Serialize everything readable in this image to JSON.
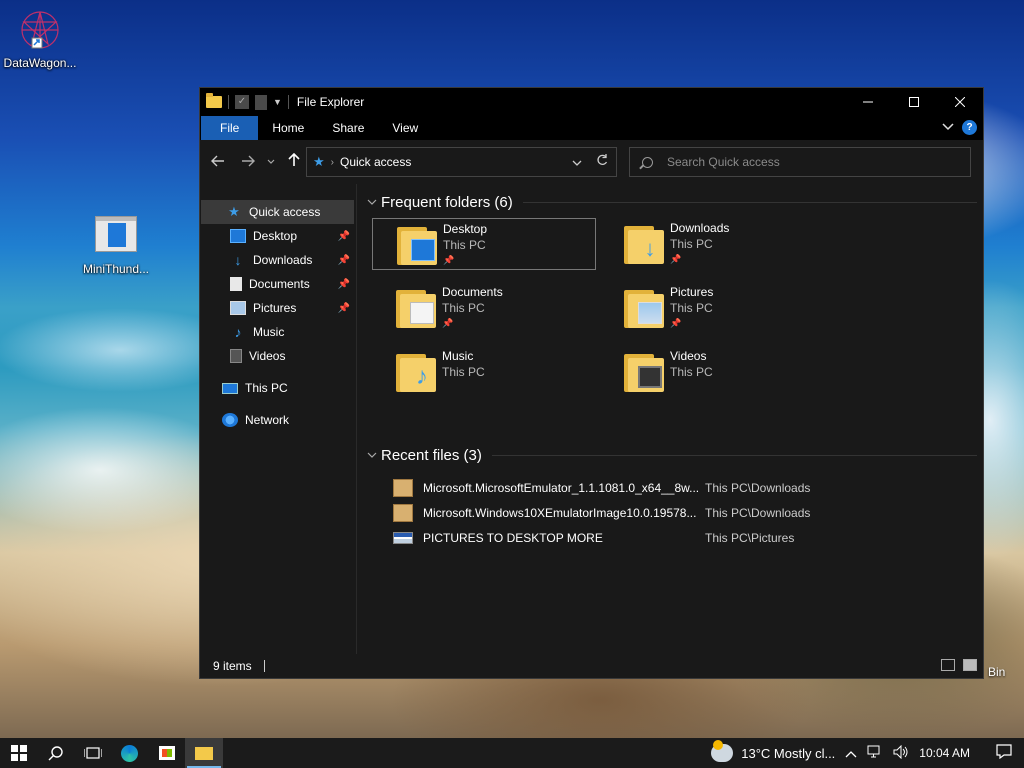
{
  "desktop": {
    "icons": [
      {
        "label": "DataWagon..."
      },
      {
        "label": "MiniThund..."
      }
    ],
    "recycle_label": "Bin"
  },
  "window": {
    "title": "File Explorer",
    "ribbon_tabs": [
      "File",
      "Home",
      "Share",
      "View"
    ],
    "address": {
      "path": "Quick access"
    },
    "search": {
      "placeholder": "Search Quick access"
    },
    "sidebar": {
      "quick_access": "Quick access",
      "items": [
        {
          "label": "Desktop",
          "icon": "desktop-icon",
          "pinned": true
        },
        {
          "label": "Downloads",
          "icon": "download-icon",
          "pinned": true
        },
        {
          "label": "Documents",
          "icon": "document-icon",
          "pinned": true
        },
        {
          "label": "Pictures",
          "icon": "pictures-icon",
          "pinned": true
        },
        {
          "label": "Music",
          "icon": "music-icon",
          "pinned": false
        },
        {
          "label": "Videos",
          "icon": "videos-icon",
          "pinned": false
        }
      ],
      "this_pc": "This PC",
      "network": "Network"
    },
    "frequent": {
      "title": "Frequent folders (6)",
      "folders": [
        {
          "name": "Desktop",
          "location": "This PC",
          "pinned": true
        },
        {
          "name": "Downloads",
          "location": "This PC",
          "pinned": true
        },
        {
          "name": "Documents",
          "location": "This PC",
          "pinned": true
        },
        {
          "name": "Pictures",
          "location": "This PC",
          "pinned": true
        },
        {
          "name": "Music",
          "location": "This PC",
          "pinned": false
        },
        {
          "name": "Videos",
          "location": "This PC",
          "pinned": false
        }
      ]
    },
    "recent": {
      "title": "Recent files (3)",
      "files": [
        {
          "name": "Microsoft.MicrosoftEmulator_1.1.1081.0_x64__8w...",
          "path": "This PC\\Downloads",
          "icon": "package-icon"
        },
        {
          "name": "Microsoft.Windows10XEmulatorImage10.0.19578...",
          "path": "This PC\\Downloads",
          "icon": "package-icon"
        },
        {
          "name": "PICTURES TO DESKTOP MORE",
          "path": "This PC\\Pictures",
          "icon": "image-icon"
        }
      ]
    },
    "status": {
      "items": "9 items"
    }
  },
  "taskbar": {
    "weather": "13°C  Mostly cl...",
    "time": "10:04 AM"
  },
  "colors": {
    "accent": "#1a5fb4",
    "window_bg": "#191919",
    "titlebar_bg": "#000000",
    "taskbar_bg": "#1b1b1b"
  }
}
